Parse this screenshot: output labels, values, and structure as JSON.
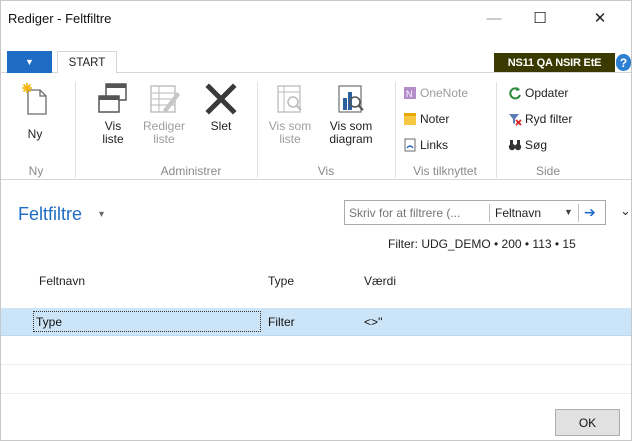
{
  "window": {
    "title": "Rediger - Feltfiltre",
    "minimize": "—",
    "maximize": "☐",
    "close": "✕"
  },
  "tabs": {
    "file_arrow": "▼",
    "start": "START",
    "company": "NS11 QA NSIR EtE",
    "help": "?"
  },
  "ribbon": {
    "ny": {
      "label": "Ny",
      "group": "Ny"
    },
    "administrer": {
      "group": "Administrer",
      "vis_liste": "Vis\nliste",
      "rediger_liste": "Rediger\nliste",
      "slet": "Slet"
    },
    "vis": {
      "group": "Vis",
      "vis_som_liste": "Vis som\nliste",
      "vis_som_diagram": "Vis som\ndiagram"
    },
    "vis_tilknyttet": {
      "group": "Vis tilknyttet",
      "onenote": "OneNote",
      "noter": "Noter",
      "links": "Links"
    },
    "side": {
      "group": "Side",
      "opdater": "Opdater",
      "ryd_filter": "Ryd filter",
      "soeg": "Søg"
    }
  },
  "page": {
    "title": "Feltfiltre",
    "caret": "▾",
    "filter_placeholder": "Skriv for at filtrere (...",
    "filter_field": "Feltnavn",
    "filter_dd": "▼",
    "filter_go": "➔",
    "collapse": "⌄",
    "filter_info": "Filter: UDG_DEMO • 200 • 113 • 15"
  },
  "grid": {
    "columns": [
      "Feltnavn",
      "Type",
      "Værdi"
    ],
    "rows": [
      {
        "feltnavn": "Type",
        "type": "Filter",
        "vaerdi": "<>''"
      }
    ]
  },
  "footer": {
    "ok": "OK"
  },
  "colors": {
    "accent": "#1e6cc4",
    "company_bg": "#3a3a00",
    "selected_row": "#cce4f7"
  }
}
